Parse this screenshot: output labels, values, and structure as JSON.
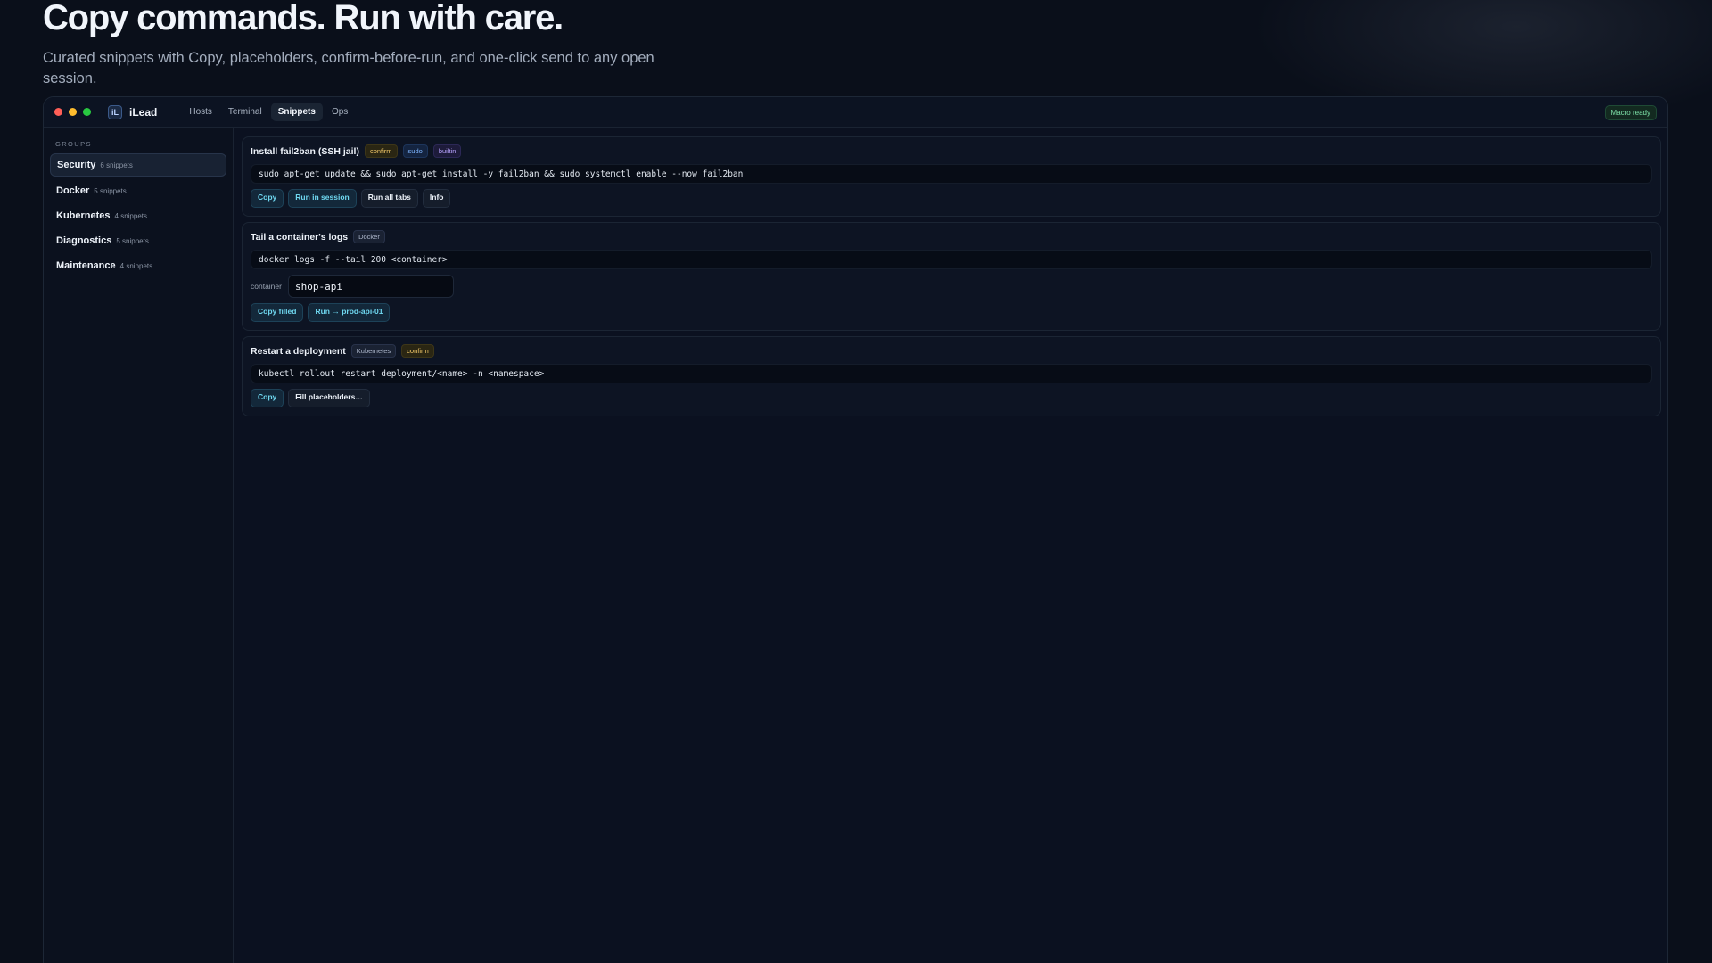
{
  "hero": {
    "title": "Copy commands. Run with care.",
    "subtitle": "Curated snippets with Copy, placeholders, confirm-before-run, and one-click send to any open session."
  },
  "window": {
    "brand": "iLead",
    "logo_text": "iL",
    "nav": [
      "Hosts",
      "Terminal",
      "Snippets",
      "Ops"
    ],
    "active_nav": "Snippets",
    "status_badge": "Macro ready"
  },
  "sidebar": {
    "heading": "GROUPS",
    "items": [
      {
        "name": "Security",
        "count": "6 snippets"
      },
      {
        "name": "Docker",
        "count": "5 snippets"
      },
      {
        "name": "Kubernetes",
        "count": "4 snippets"
      },
      {
        "name": "Diagnostics",
        "count": "5 snippets"
      },
      {
        "name": "Maintenance",
        "count": "4 snippets"
      }
    ]
  },
  "snippets": [
    {
      "title": "Install fail2ban (SSH jail)",
      "tags": [
        "confirm",
        "sudo",
        "builtin"
      ],
      "command": "sudo apt-get update && sudo apt-get install -y fail2ban && sudo systemctl enable --now fail2ban",
      "actions": [
        "Copy",
        "Run in session",
        "Run all tabs",
        "Info"
      ]
    },
    {
      "title": "Tail a container's logs",
      "tags": [
        "Docker"
      ],
      "command": "docker logs -f --tail 200 <container>",
      "param_label": "container",
      "param_value": "shop-api",
      "actions": [
        "Copy filled",
        "Run → prod-api-01"
      ]
    },
    {
      "title": "Restart a deployment",
      "tags": [
        "Kubernetes",
        "confirm"
      ],
      "command": "kubectl rollout restart deployment/<name> -n <namespace>",
      "actions": [
        "Copy",
        "Fill placeholders…"
      ]
    }
  ],
  "colors": {
    "background": "#0a0f1a",
    "accent": "#6fd8f0",
    "confirm": "#f3c969",
    "ready": "#7ee2a8"
  }
}
